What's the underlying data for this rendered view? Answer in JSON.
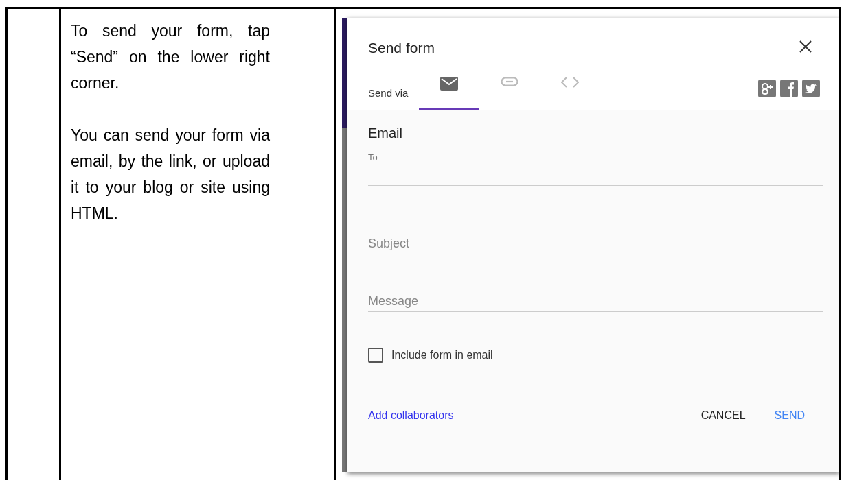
{
  "instructions": [
    "To send your form, tap “Send” on the lower right corner.",
    "You can send your form via email, by the link, or upload it to your blog or site using HTML."
  ],
  "dialog": {
    "title": "Send form",
    "send_via_label": "Send via",
    "tabs": [
      {
        "kind": "email",
        "selected": true
      },
      {
        "kind": "link",
        "selected": false
      },
      {
        "kind": "embed",
        "selected": false
      }
    ],
    "share_icons": [
      {
        "kind": "google-plus"
      },
      {
        "kind": "facebook"
      },
      {
        "kind": "twitter"
      }
    ],
    "section_title": "Email",
    "to_label": "To",
    "subject_placeholder": "Subject",
    "message_placeholder": "Message",
    "include_form": {
      "label": "Include form in email",
      "checked": false
    },
    "collaborators_link": "Add collaborators",
    "buttons": [
      {
        "label": "CANCEL",
        "kind": "cancel"
      },
      {
        "label": "SEND",
        "kind": "primary"
      }
    ]
  }
}
